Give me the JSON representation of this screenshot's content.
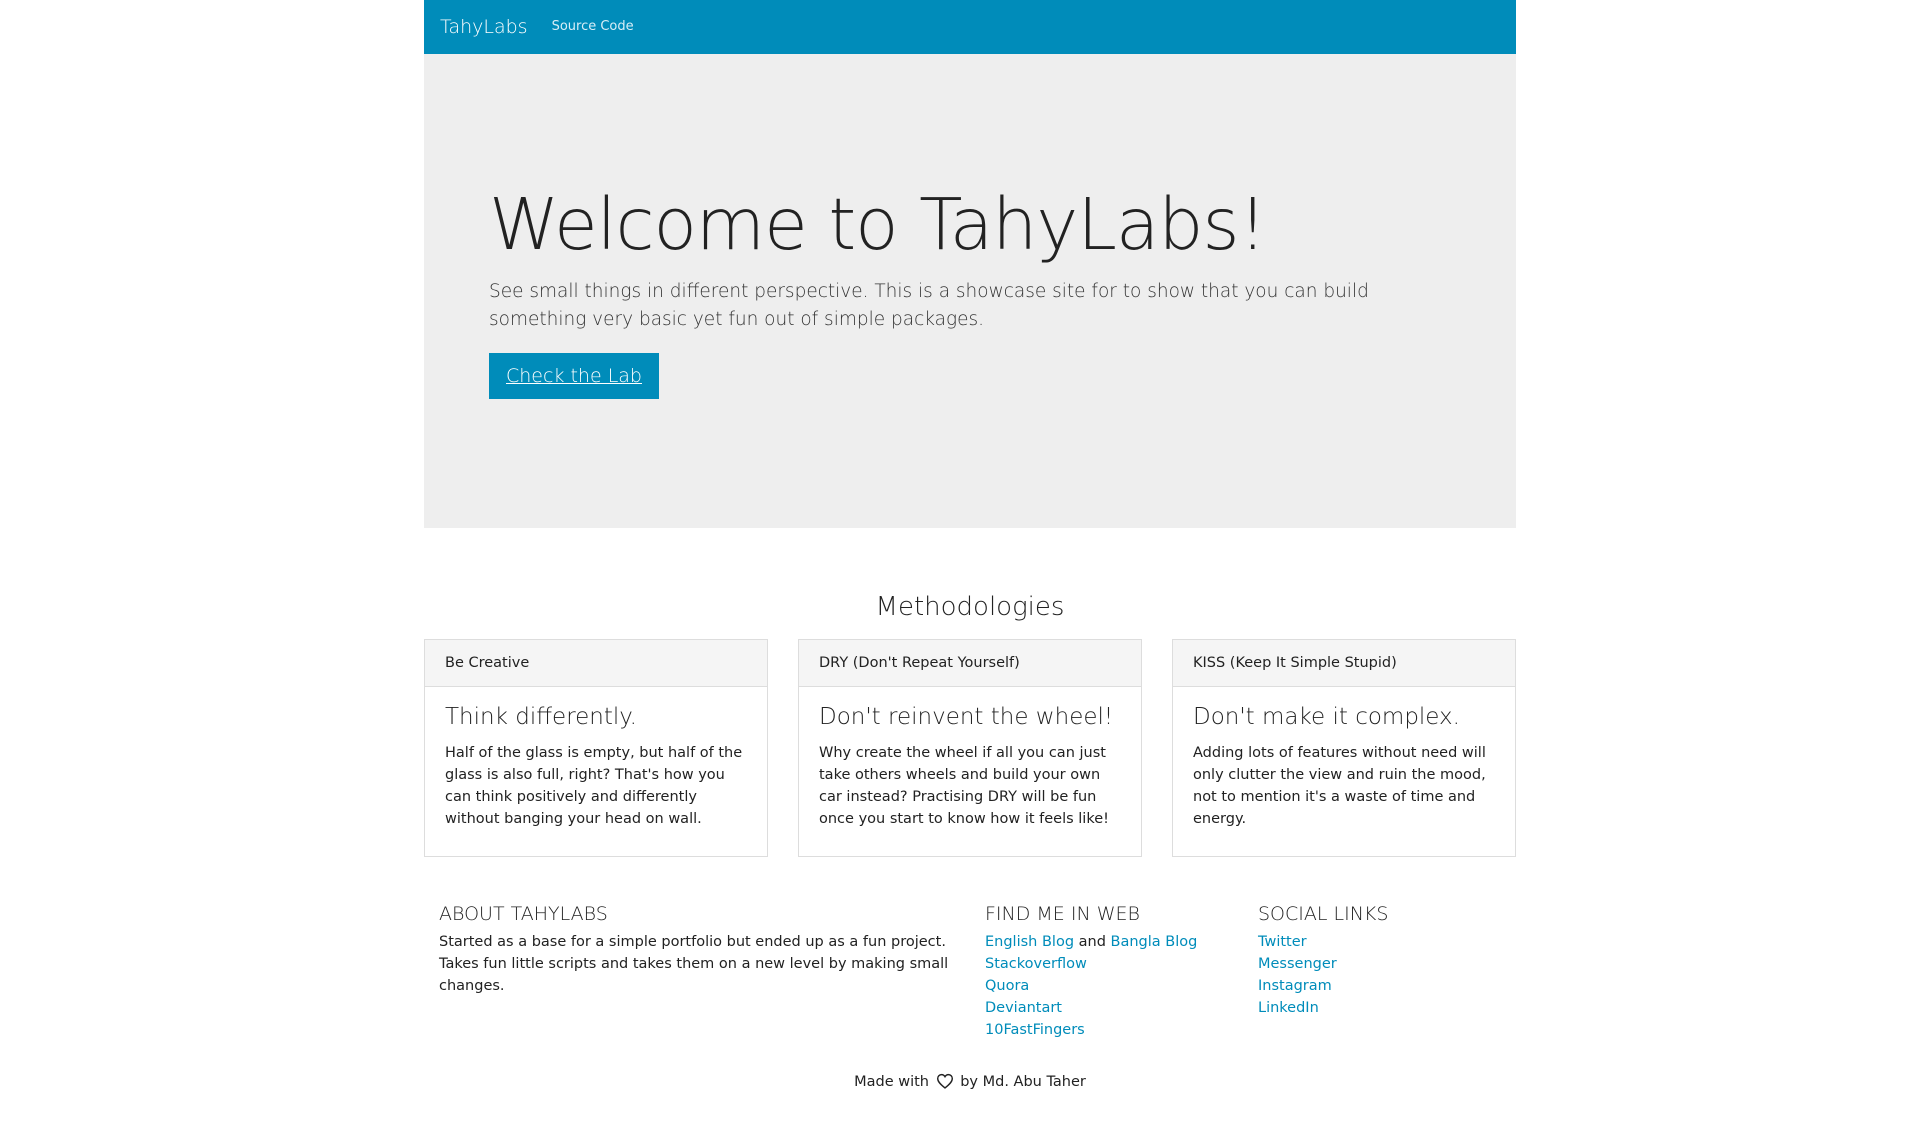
{
  "navbar": {
    "brand": "TahyLabs",
    "links": [
      {
        "label": "Source Code"
      }
    ]
  },
  "hero": {
    "title": "Welcome to TahyLabs!",
    "description": "See small things in different perspective. This is a showcase site for to show that you can build something very basic yet fun out of simple packages.",
    "button_label": "Check the Lab"
  },
  "methodologies": {
    "title": "Methodologies",
    "cards": [
      {
        "header": "Be Creative",
        "title": "Think differently.",
        "text": "Half of the glass is empty, but half of the glass is also full, right? That's how you can think positively and differently without banging your head on wall."
      },
      {
        "header": "DRY (Don't Repeat Yourself)",
        "title": "Don't reinvent the wheel!",
        "text": "Why create the wheel if all you can just take others wheels and build your own car instead? Practising DRY will be fun once you start to know how it feels like!"
      },
      {
        "header": "KISS (Keep It Simple Stupid)",
        "title": "Don't make it complex.",
        "text": "Adding lots of features without need will only clutter the view and ruin the mood, not to mention it's a waste of time and energy."
      }
    ]
  },
  "footer": {
    "about": {
      "title": "About TahyLabs",
      "text": "Started as a base for a simple portfolio but ended up as a fun project. Takes fun little scripts and takes them on a new level by making small changes."
    },
    "web": {
      "title": "Find me in web",
      "english_blog": "English Blog",
      "and": "and",
      "bangla_blog": "Bangla Blog",
      "links": [
        "Stackoverflow",
        "Quora",
        "Deviantart",
        "10FastFingers"
      ]
    },
    "social": {
      "title": "Social Links",
      "links": [
        "Twitter",
        "Messenger",
        "Instagram",
        "LinkedIn"
      ]
    },
    "made_prefix": "Made with",
    "made_suffix": "by Md. Abu Taher",
    "heart_icon": "heart-outline-icon"
  },
  "colors": {
    "primary": "#008cba",
    "hero_bg": "#eeeeee",
    "card_header_bg": "#f5f5f5"
  }
}
